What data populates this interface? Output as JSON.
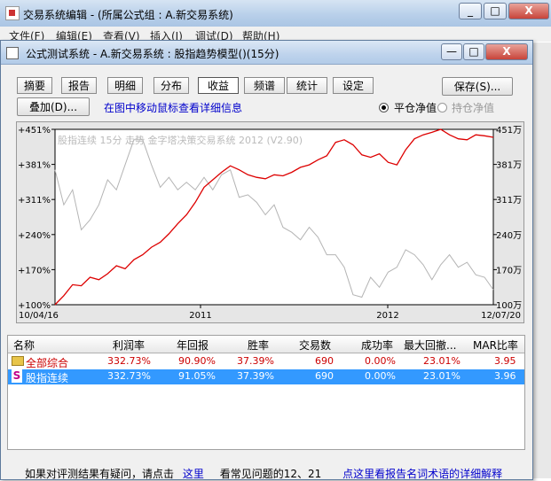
{
  "outer_window": {
    "title": "交易系统编辑 - (所属公式组 : A.新交易系统)",
    "menu": [
      "文件(F)",
      "编辑(E)",
      "查看(V)",
      "插入(I)",
      "调试(D)",
      "帮助(H)"
    ],
    "minimize": "_",
    "maximize": "□",
    "close": "X"
  },
  "dialog": {
    "title": "公式测试系统 - A.新交易系统 : 股指趋势模型()(15分)",
    "minimize": "—",
    "maximize": "□",
    "close": "X"
  },
  "tabs": [
    "摘要",
    "报告",
    "明细",
    "分布",
    "收益",
    "频谱",
    "统计",
    "设定"
  ],
  "active_tab": "收益",
  "buttons": {
    "save": "保存(S)...",
    "overlay": "叠加(D)..."
  },
  "hint": "在图中移动鼠标查看详细信息",
  "radios": {
    "flat_label": "平仓净值",
    "hold_label": "持仓净值",
    "selected": "平仓净值"
  },
  "chart_data": {
    "type": "line",
    "watermark": "股指连续 15分 走势   金字塔决策交易系统 2012 (V2.90)",
    "y_left_ticks": [
      "+451%",
      "+381%",
      "+311%",
      "+240%",
      "+170%",
      "+100%"
    ],
    "y_right_ticks": [
      "451万",
      "381万",
      "311万",
      "240万",
      "170万",
      "100万"
    ],
    "ylim": [
      100,
      451
    ],
    "x_labels": {
      "start": "10/04/16",
      "mid1": "2011",
      "mid2": "2012",
      "end": "12/07/20"
    },
    "series": [
      {
        "name": "equity",
        "color": "#dd0000",
        "x": [
          0,
          2,
          4,
          6,
          8,
          10,
          12,
          14,
          16,
          18,
          20,
          22,
          24,
          26,
          28,
          30,
          32,
          34,
          36,
          38,
          40,
          42,
          44,
          46,
          48,
          50,
          52,
          54,
          56,
          58,
          60,
          62,
          64,
          66,
          68,
          70,
          72,
          74,
          76,
          78,
          80,
          82,
          84,
          86,
          88,
          90,
          92,
          94,
          96,
          98,
          100
        ],
        "y": [
          100,
          118,
          140,
          138,
          155,
          150,
          162,
          178,
          172,
          190,
          200,
          215,
          225,
          242,
          262,
          280,
          305,
          335,
          350,
          365,
          378,
          370,
          360,
          355,
          352,
          360,
          358,
          365,
          375,
          380,
          390,
          398,
          425,
          430,
          420,
          400,
          395,
          402,
          385,
          380,
          410,
          432,
          440,
          445,
          458,
          440,
          432,
          430,
          440,
          438,
          435
        ]
      },
      {
        "name": "index",
        "color": "#b4b4b4",
        "x": [
          0,
          2,
          4,
          6,
          8,
          10,
          12,
          14,
          16,
          18,
          20,
          22,
          24,
          26,
          28,
          30,
          32,
          34,
          36,
          38,
          40,
          42,
          44,
          46,
          48,
          50,
          52,
          54,
          56,
          58,
          60,
          62,
          64,
          66,
          68,
          70,
          72,
          74,
          76,
          78,
          80,
          82,
          84,
          86,
          88,
          90,
          92,
          94,
          96,
          98,
          100
        ],
        "y": [
          370,
          300,
          330,
          250,
          270,
          300,
          350,
          330,
          380,
          430,
          430,
          380,
          335,
          355,
          330,
          345,
          330,
          355,
          330,
          360,
          370,
          315,
          320,
          305,
          280,
          300,
          255,
          245,
          230,
          255,
          235,
          200,
          200,
          175,
          120,
          115,
          155,
          135,
          165,
          175,
          210,
          200,
          180,
          150,
          180,
          200,
          175,
          185,
          160,
          155,
          130
        ]
      }
    ]
  },
  "table": {
    "columns": [
      "名称",
      "利润率",
      "年回报",
      "胜率",
      "交易数",
      "成功率",
      "最大回撤...",
      "MAR比率"
    ],
    "rows": [
      {
        "icon": "folder-icon",
        "values": [
          "全部综合",
          "332.73%",
          "90.90%",
          "37.39%",
          "690",
          "0.00%",
          "23.01%",
          "3.95"
        ]
      },
      {
        "icon": "s-icon",
        "values": [
          "股指连续",
          "332.73%",
          "91.05%",
          "37.39%",
          "690",
          "0.00%",
          "23.01%",
          "3.96"
        ]
      }
    ]
  },
  "footer": {
    "text1": "如果对评测结果有疑问，请点击",
    "link1": "这里",
    "text2": "看常见问题的12、21",
    "link2": "点这里看报告名词术语的详细解释"
  }
}
